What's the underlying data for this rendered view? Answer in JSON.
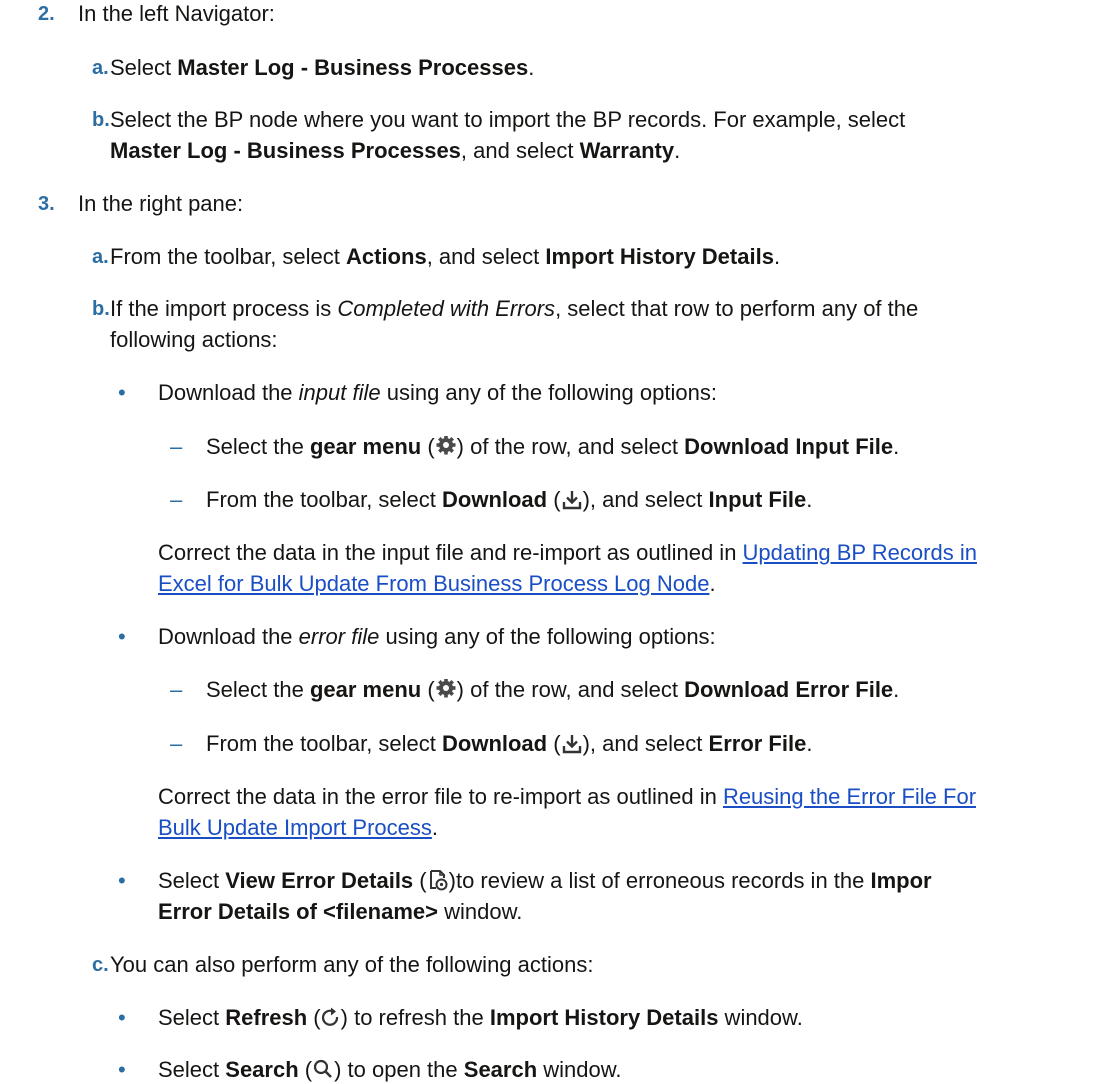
{
  "step2": {
    "num": "2.",
    "intro": "In the left Navigator:",
    "a": {
      "label": "a.",
      "pre": "Select ",
      "bold": "Master Log - Business Processes",
      "post": "."
    },
    "b": {
      "label": "b.",
      "line1": "Select the BP node where you want to import the BP records. For example, select",
      "bold1": "Master Log - Business Processes",
      "mid": ", and select ",
      "bold2": "Warranty",
      "end": "."
    }
  },
  "step3": {
    "num": "3.",
    "intro": "In the right pane:",
    "a": {
      "label": "a.",
      "pre": "From the toolbar, select ",
      "bold1": "Actions",
      "mid": ", and select ",
      "bold2": "Import History Details",
      "end": "."
    },
    "b": {
      "label": "b.",
      "pre": "If the import process is ",
      "italic": "Completed with Errors",
      "post": ", select that row to perform any of the",
      "line2": "following actions:",
      "input": {
        "pre": "Download the ",
        "italic": "input file",
        "post": " using any of the following options:",
        "opt1": {
          "pre": "Select the ",
          "bold1": "gear menu",
          "open": " (",
          "close": ") of the row, and select ",
          "bold2": "Download Input File",
          "end": "."
        },
        "opt2": {
          "pre": "From the toolbar, select ",
          "bold1": "Download",
          "open": " (",
          "close": "), and select ",
          "bold2": "Input File",
          "end": "."
        },
        "note_pre": "Correct the data in the input file and re-import as outlined in ",
        "link1": "Updating BP Records in",
        "link2": "Excel for Bulk Update From Business Process Log Node",
        "note_end": "."
      },
      "error": {
        "pre": "Download the ",
        "italic": "error file",
        "post": " using any of the following options:",
        "opt1": {
          "pre": "Select the ",
          "bold1": "gear menu",
          "open": " (",
          "close": ") of the row, and select ",
          "bold2": "Download Error File",
          "end": "."
        },
        "opt2": {
          "pre": "From the toolbar, select ",
          "bold1": "Download",
          "open": " (",
          "close": "), and select ",
          "bold2": "Error File",
          "end": "."
        },
        "note_pre": "Correct the data in the error file to re-import as outlined in ",
        "link1": "Reusing the Error File For",
        "link2": "Bulk Update Import Process",
        "note_end": "."
      },
      "view": {
        "pre": "Select ",
        "bold1": "View Error Details",
        "open": " (",
        "close": ")to review a list of erroneous records in the ",
        "bold2": "Impor",
        "bold3": "Error Details of <filename>",
        "end": " window."
      }
    },
    "c": {
      "label": "c.",
      "text": "You can also perform any of the following actions:",
      "refresh": {
        "pre": "Select ",
        "bold1": "Refresh",
        "open": " (",
        "close": ") to refresh the ",
        "bold2": "Import History Details",
        "end": " window."
      },
      "search": {
        "pre": "Select ",
        "bold1": "Search",
        "open": " (",
        "close": ") to open the ",
        "bold2": "Search",
        "end": " window."
      }
    }
  },
  "icons": {
    "gear": "gear-icon",
    "download": "download-icon",
    "view": "view-error-details-icon",
    "refresh": "refresh-icon",
    "search": "search-icon"
  },
  "colors": {
    "numbering": "#2c6ea3",
    "link": "#1a4ec5",
    "text": "#161513"
  }
}
